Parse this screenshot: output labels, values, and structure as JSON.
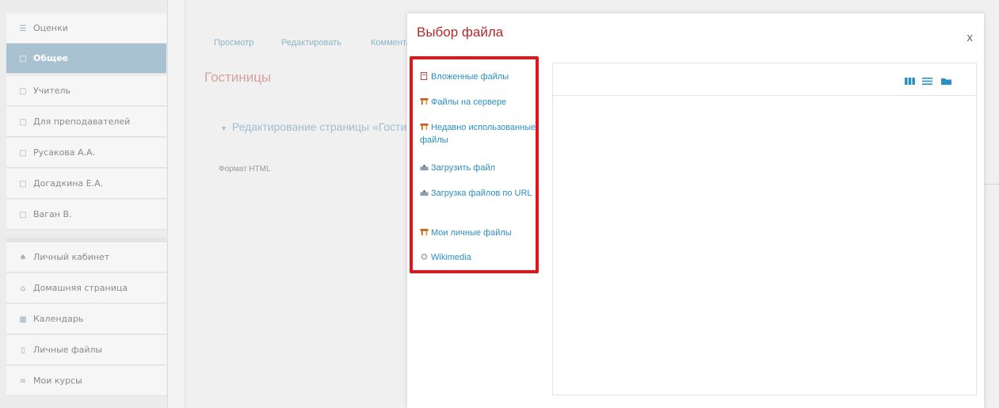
{
  "sidebar": {
    "items": [
      {
        "label": "Оценки",
        "icon": "grades-icon",
        "active": false
      },
      {
        "label": "Общее",
        "icon": "folder-icon",
        "active": true
      },
      {
        "label": "Учитель",
        "icon": "folder-icon",
        "active": false
      },
      {
        "label": "Для преподавателей",
        "icon": "folder-icon",
        "active": false
      },
      {
        "label": "Русакова А.А.",
        "icon": "folder-icon",
        "active": false
      },
      {
        "label": "Догадкина Е.А.",
        "icon": "folder-icon",
        "active": false
      },
      {
        "label": "Ваган В.",
        "icon": "folder-icon",
        "active": false
      },
      {
        "label": "Личный кабинет",
        "icon": "dashboard-icon",
        "active": false
      },
      {
        "label": "Домашняя страница",
        "icon": "home-icon",
        "active": false
      },
      {
        "label": "Календарь",
        "icon": "calendar-icon",
        "active": false
      },
      {
        "label": "Личные файлы",
        "icon": "file-icon",
        "active": false
      },
      {
        "label": "Мои курсы",
        "icon": "courses-icon",
        "active": false
      }
    ]
  },
  "main": {
    "tabs": [
      "Просмотр",
      "Редактировать",
      "Комментарии"
    ],
    "page_title": "Гостиницы",
    "section_title": "Редактирование страницы «Гостиницы»",
    "format_label": "Формат HTML"
  },
  "modal": {
    "title": "Выбор файла",
    "close_label": "x",
    "repositories": [
      {
        "label": "Вложенные файлы",
        "icon": "attachment-icon"
      },
      {
        "label": "Файлы на сервере",
        "icon": "server-files-icon"
      },
      {
        "label": "Недавно использованные файлы",
        "icon": "recent-files-icon"
      },
      {
        "label": "Загрузить файл",
        "icon": "upload-icon"
      },
      {
        "label": "Загрузка файлов по URL",
        "icon": "url-download-icon"
      },
      {
        "label": "Мои личные файлы",
        "icon": "private-files-icon"
      },
      {
        "label": "Wikimedia",
        "icon": "wikimedia-icon"
      }
    ],
    "view_modes": [
      "icons-view-icon",
      "list-view-icon",
      "tree-view-icon"
    ]
  },
  "colors": {
    "highlight": "#e0161b",
    "link": "#2a8fc4",
    "modal_title": "#b22a2a",
    "active_sidebar": "#a8c2d2"
  }
}
